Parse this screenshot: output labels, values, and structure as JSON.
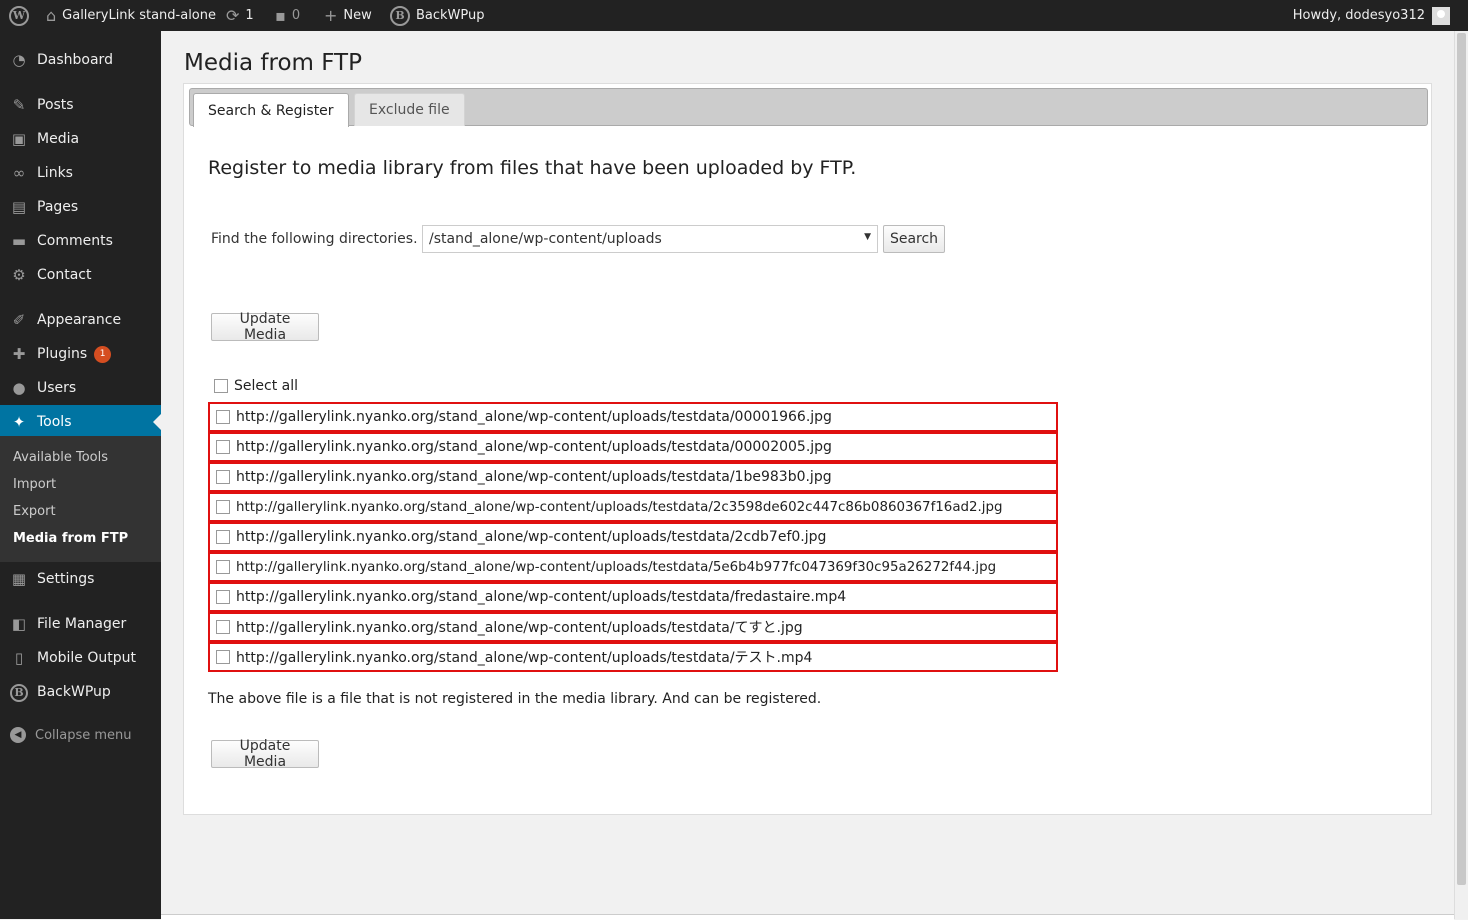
{
  "adminbar": {
    "site_name": "GalleryLink stand-alone",
    "updates_count": "1",
    "comments_count": "0",
    "new_label": "New",
    "backwpup_label": "BackWPup",
    "howdy": "Howdy, dodesyo312"
  },
  "sidebar": {
    "items": [
      {
        "label": "Dashboard",
        "icon": "dashboard-icon"
      },
      {
        "label": "Posts",
        "icon": "pin-icon"
      },
      {
        "label": "Media",
        "icon": "media-icon"
      },
      {
        "label": "Links",
        "icon": "link-icon"
      },
      {
        "label": "Pages",
        "icon": "pages-icon"
      },
      {
        "label": "Comments",
        "icon": "comment-icon"
      },
      {
        "label": "Contact",
        "icon": "gear-icon"
      },
      {
        "label": "Appearance",
        "icon": "brush-icon"
      },
      {
        "label": "Plugins",
        "icon": "plug-icon",
        "badge": "1"
      },
      {
        "label": "Users",
        "icon": "user-icon"
      },
      {
        "label": "Tools",
        "icon": "wrench-icon"
      },
      {
        "label": "Settings",
        "icon": "sliders-icon"
      },
      {
        "label": "File Manager",
        "icon": "file-manager-icon"
      },
      {
        "label": "Mobile Output",
        "icon": "mobile-icon"
      },
      {
        "label": "BackWPup",
        "icon": "backwpup-icon"
      }
    ],
    "submenu": [
      "Available Tools",
      "Import",
      "Export",
      "Media from FTP"
    ],
    "collapse_label": "Collapse menu"
  },
  "page": {
    "title": "Media from FTP",
    "tabs": [
      "Search & Register",
      "Exclude file"
    ],
    "intro": "Register to media library from files that have been uploaded by FTP.",
    "find_label": "Find the following directories.",
    "directory_value": "/stand_alone/wp-content/uploads",
    "search_button": "Search",
    "update_button": "Update Media",
    "select_all_label": "Select all",
    "files": [
      "http://gallerylink.nyanko.org/stand_alone/wp-content/uploads/testdata/00001966.jpg",
      "http://gallerylink.nyanko.org/stand_alone/wp-content/uploads/testdata/00002005.jpg",
      "http://gallerylink.nyanko.org/stand_alone/wp-content/uploads/testdata/1be983b0.jpg",
      "http://gallerylink.nyanko.org/stand_alone/wp-content/uploads/testdata/2c3598de602c447c86b0860367f16ad2.jpg",
      "http://gallerylink.nyanko.org/stand_alone/wp-content/uploads/testdata/2cdb7ef0.jpg",
      "http://gallerylink.nyanko.org/stand_alone/wp-content/uploads/testdata/5e6b4b977fc047369f30c95a26272f44.jpg",
      "http://gallerylink.nyanko.org/stand_alone/wp-content/uploads/testdata/fredastaire.mp4",
      "http://gallerylink.nyanko.org/stand_alone/wp-content/uploads/testdata/てすと.jpg",
      "http://gallerylink.nyanko.org/stand_alone/wp-content/uploads/testdata/テスト.mp4"
    ],
    "note": "The above file is a file that is not registered in the media library. And can be registered."
  },
  "colors": {
    "adminbar_bg": "#222222",
    "active_menu": "#0074a2",
    "highlight_border": "#e01010",
    "badge": "#d54e21"
  }
}
